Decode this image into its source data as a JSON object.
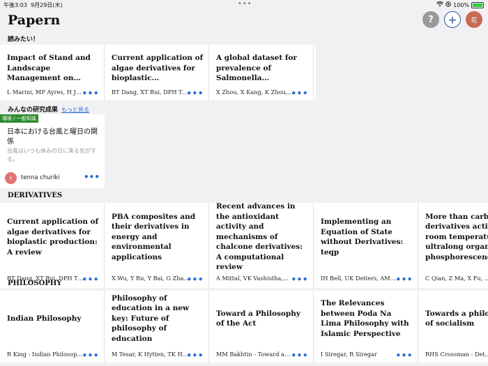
{
  "status_bar": {
    "time": "午後3:03",
    "date": "9月29日(木)",
    "battery": "100%",
    "battery_level": 1.0
  },
  "header": {
    "title": "Papern",
    "help_label": "?",
    "add_label": "+",
    "avatar_label": "花"
  },
  "want_to_read": {
    "label": "読みたい！",
    "cards": [
      {
        "title": "Impact of Stand and Landscape Management on Forest Pest Damage",
        "authors": "L Marini, MP Ayres, H J…"
      },
      {
        "title": "Current application of algae derivatives for bioplastic production:…",
        "authors": "BT Dang, XT Bui, DPH T…"
      },
      {
        "title": "A global dataset for prevalence of Salmonella Gallinaru…",
        "authors": "X Zhou, X Kang, K Zhou,…"
      }
    ]
  },
  "community": {
    "label": "みんなの研究成果",
    "more_label": "もっと見る",
    "card": {
      "tag": "環境 / 一般知識",
      "title": "日本における台風と曜日の関係",
      "description": "台風はいつも休みの日に来る気がする。",
      "avatar_initial": "t",
      "user": "tenna churiki"
    }
  },
  "derivatives": {
    "label": "DERIVATIVES",
    "cards": [
      {
        "title": "Current application of algae derivatives for bioplastic production: A review",
        "authors": "BT Dang, XT Bui, DPH T…"
      },
      {
        "title": "PBA composites and their derivatives in energy and environmental applications",
        "authors": "X Wu, Y Ru, Y Bai, G Zha…"
      },
      {
        "title": "Recent advances in the antioxidant activity and mechanisms of chalcone derivatives: A computational review",
        "authors": "A Mittal, VK Vashistha,…"
      },
      {
        "title": "Implementing an Equation of State without Derivatives: teqp",
        "authors": "IH Bell, UK Deiters, AM…"
      },
      {
        "title": "More than carbazole derivatives activate room temperature ultralong organic phosphorescence",
        "authors": "C Qian, Z Ma, X Fu, …"
      }
    ]
  },
  "philosophy": {
    "label": "PHILOSOPHY",
    "cards": [
      {
        "title": "Indian Philosophy",
        "authors": "R King - Indian Philosop…"
      },
      {
        "title": "Philosophy of education in a new key: Future of philosophy of education",
        "authors": "M Tesar, K Hytten, TK H…"
      },
      {
        "title": "Toward a Philosophy of the Act",
        "authors": "MM Bakhtin - Toward a…"
      },
      {
        "title": "The Relevances between Poda Na Lima Philosophy with Islamic Perspective",
        "authors": "I Siregar, R Siregar"
      },
      {
        "title": "Towards a philosophy of socialism",
        "authors": "RHS Crossman - Det…"
      }
    ]
  },
  "more_glyph": "•••"
}
